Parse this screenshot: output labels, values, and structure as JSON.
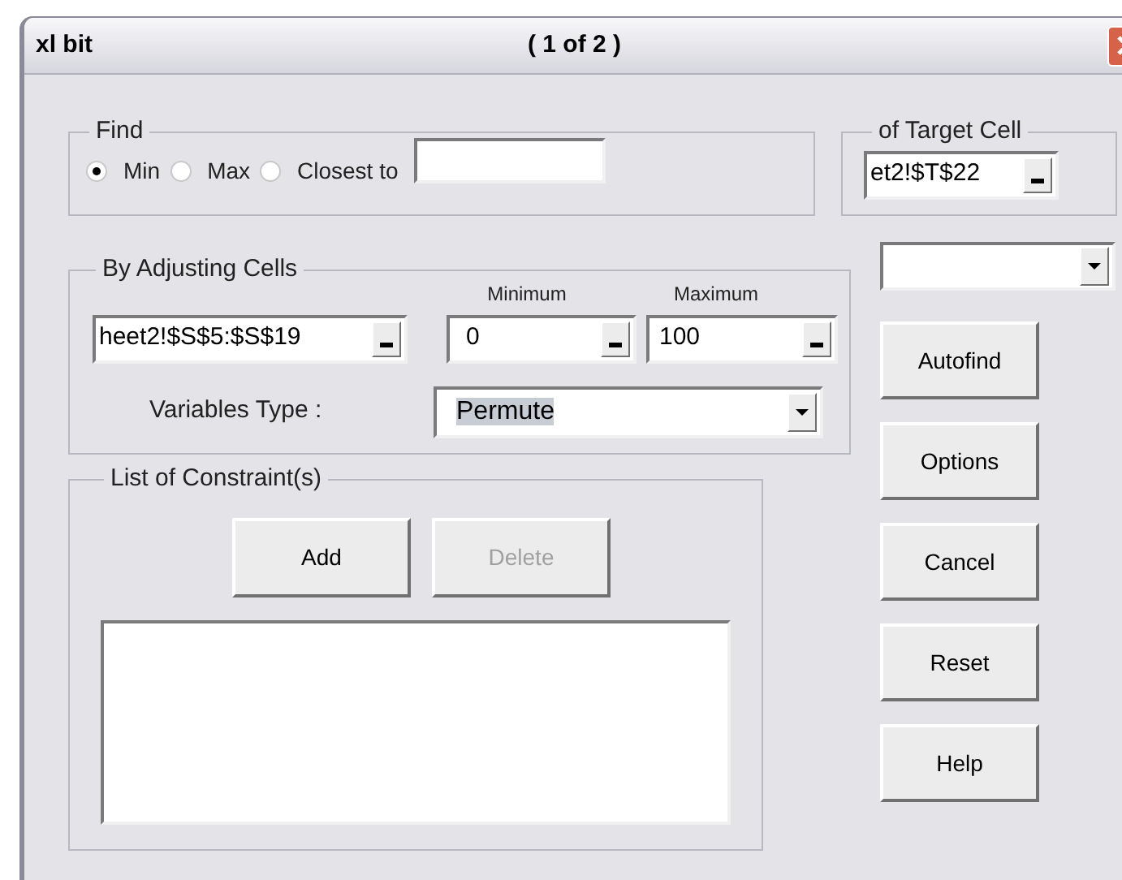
{
  "window": {
    "title": "xl bit",
    "page": "( 1 of 2 )"
  },
  "find": {
    "label": "Find",
    "options": [
      {
        "label": "Min",
        "selected": true
      },
      {
        "label": "Max",
        "selected": false
      },
      {
        "label": "Closest to",
        "selected": false
      }
    ]
  },
  "target_cell": {
    "label": "of Target Cell",
    "value": "et2!$T$22"
  },
  "adjusting": {
    "label": "By Adjusting Cells",
    "cells": "heet2!$S$5:$S$19",
    "minimum_label": "Minimum",
    "minimum": "0",
    "maximum_label": "Maximum",
    "maximum": "100",
    "variables_type_label": "Variables Type :",
    "variables_type": "Permute"
  },
  "constraints": {
    "label": "List of Constraint(s)",
    "buttons": [
      {
        "label": "Add",
        "disabled": false
      },
      {
        "label": "Delete",
        "disabled": true
      }
    ]
  },
  "side_buttons": [
    "Autofind",
    "Options",
    "Cancel",
    "Reset",
    "Help"
  ]
}
